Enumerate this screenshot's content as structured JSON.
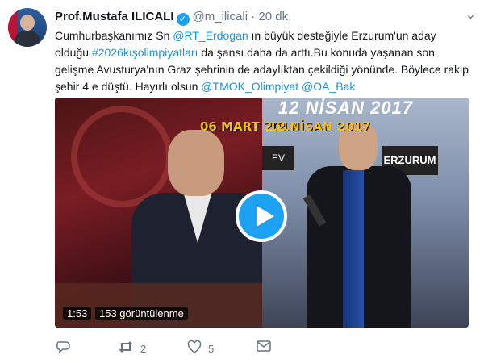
{
  "tweet": {
    "author_name": "Prof.Mustafa ILICALI",
    "handle": "@m_ilicali",
    "separator": "·",
    "time": "20 dk.",
    "text_parts": {
      "p1": "Cumhurbaşkanımız Sn ",
      "mention_erdogan": "@RT_Erdogan",
      "p2": " ın büyük desteğiyle Erzurum'un aday olduğu ",
      "hashtag": "#2026kışolimpiyatları",
      "p3": " da şansı daha da arttı.Bu konuda yaşanan son gelişme Avusturya'nın Graz şehrinin de adaylıktan çekildiği yönünde. Böylece rakip şehir 4 e düştü. Hayırlı olsun ",
      "mention_tmok": "@TMOK_Olimpiyat",
      "p4": " ",
      "mention_oa": "@OA_Bak"
    },
    "video": {
      "date_left": "06 MART 2017",
      "date_right": "12 NİSAN 2017",
      "banner_top": "12 NİSAN 2017",
      "sign_right": "ERZURUM",
      "sign_left": "EV",
      "duration": "1:53",
      "views": "153 görüntülenme"
    },
    "actions": {
      "reply_icon": "reply-icon",
      "retweet_icon": "retweet-icon",
      "retweet_count": "2",
      "like_icon": "heart-icon",
      "like_count": "5",
      "dm_icon": "envelope-icon"
    },
    "colors": {
      "link": "#1b95e0",
      "verified": "#1da1f2",
      "play": "#1da1f2",
      "muted": "#657786",
      "date_overlay": "#f2c010"
    }
  }
}
